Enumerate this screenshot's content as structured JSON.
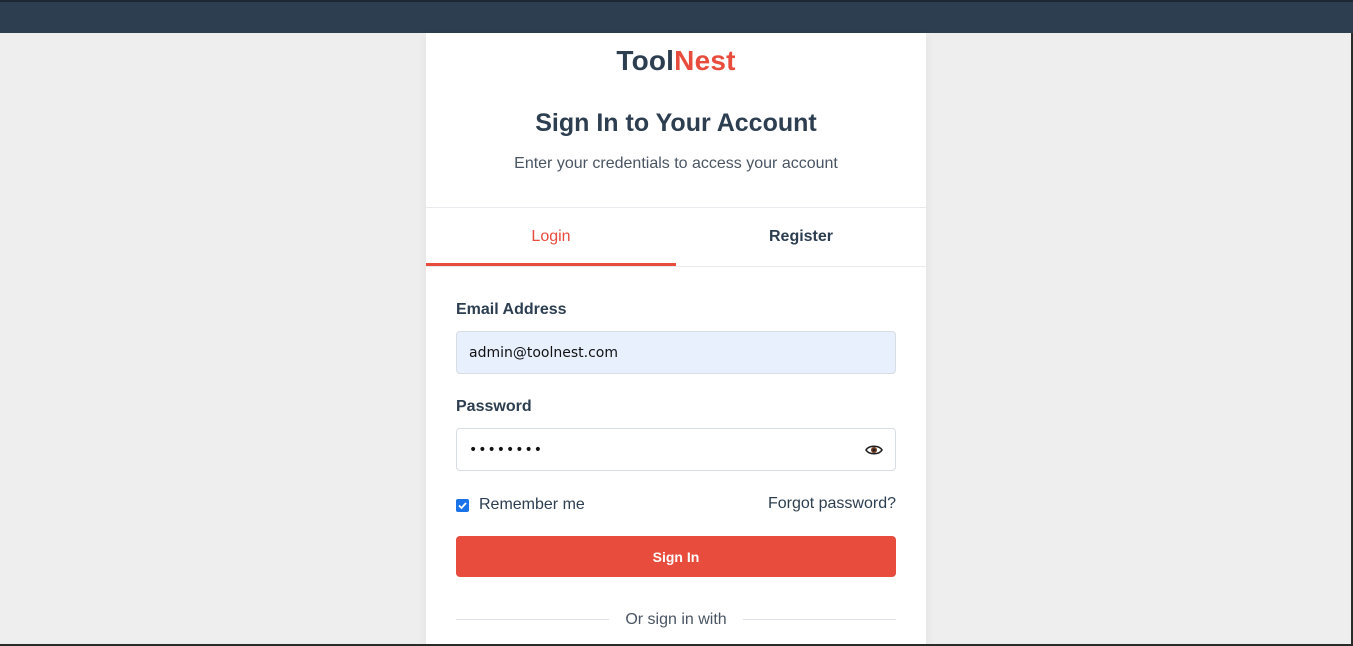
{
  "brand": {
    "part1": "Tool",
    "part2": "Nest"
  },
  "header": {
    "title": "Sign In to Your Account",
    "subtitle": "Enter your credentials to access your account"
  },
  "tabs": [
    {
      "label": "Login",
      "active": true
    },
    {
      "label": "Register",
      "active": false
    }
  ],
  "form": {
    "email_label": "Email Address",
    "email_value": "admin@toolnest.com",
    "password_label": "Password",
    "password_value": "••••••••",
    "remember_label": "Remember me",
    "remember_checked": true,
    "forgot_label": "Forgot password?",
    "submit_label": "Sign In",
    "alt_signin_label": "Or sign in with"
  },
  "colors": {
    "accent": "#e74c3c",
    "navy": "#2c3e50",
    "autofill_bg": "#e8f0fe",
    "checkbox": "#1a73e8"
  },
  "icons": {
    "password_toggle": "eye-icon",
    "remember": "checkmark-icon"
  }
}
